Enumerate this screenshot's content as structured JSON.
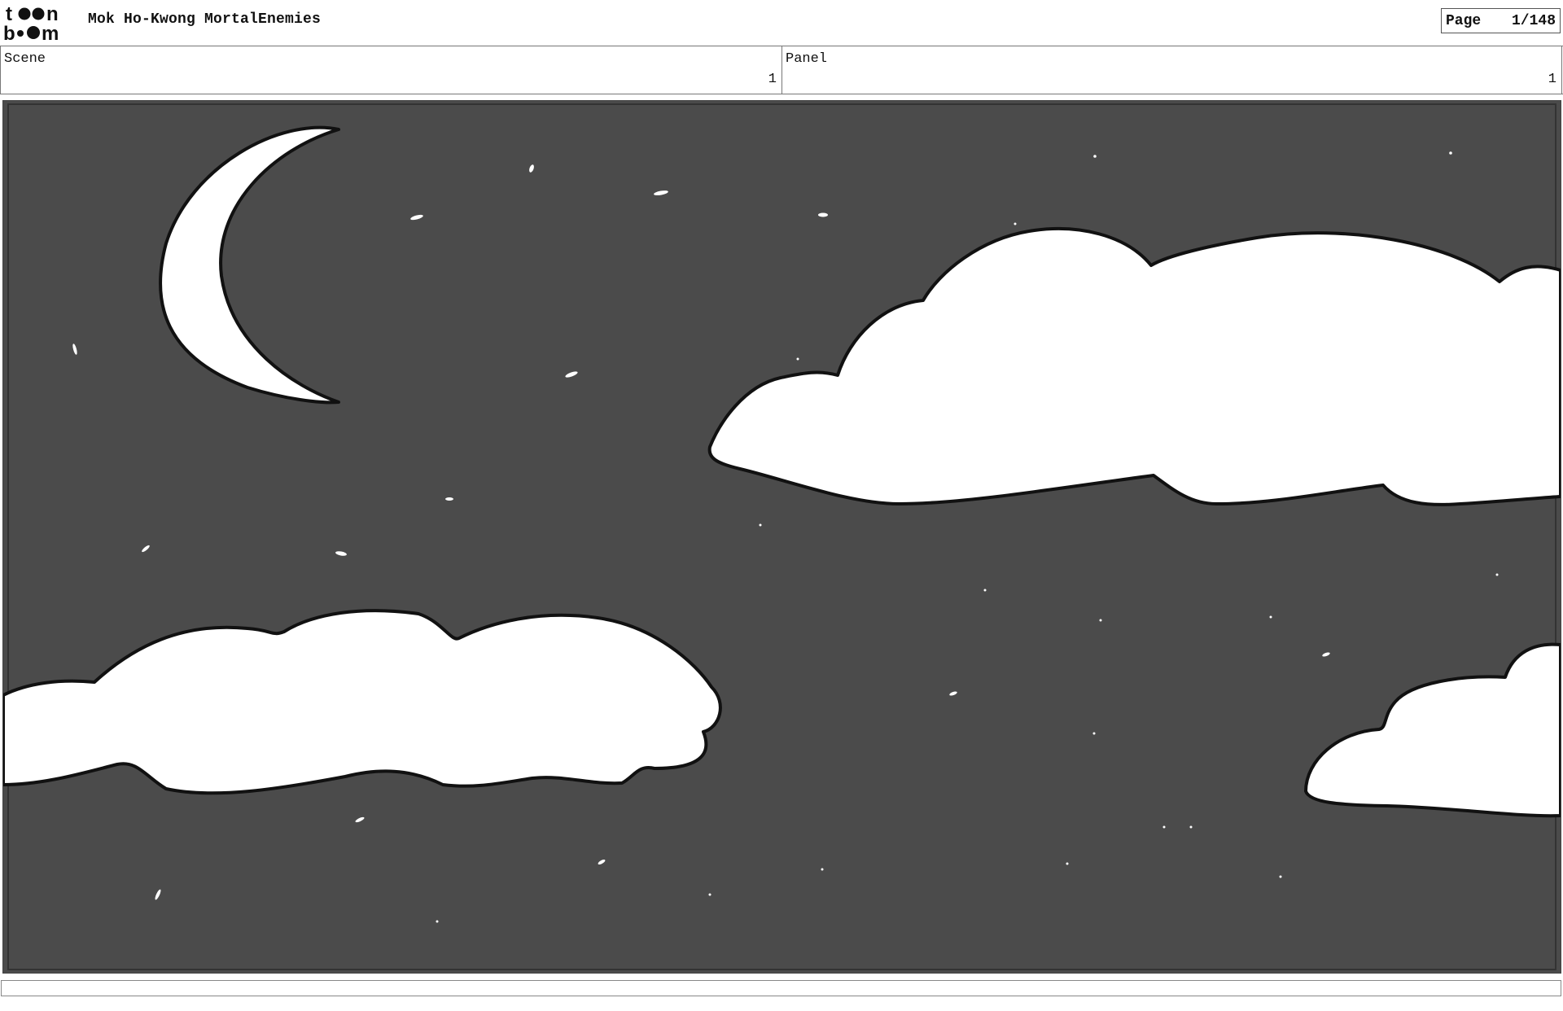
{
  "header": {
    "logo_text_top": "toon",
    "logo_text_bottom": "boom",
    "project_title": "Mok Ho-Kwong MortalEnemies",
    "page_label": "Page",
    "page_value": "1/148"
  },
  "info": {
    "scene_label": "Scene",
    "scene_value": "1",
    "panel_label": "Panel",
    "panel_value": "1"
  },
  "drawing": {
    "background_color": "#4b4b4b",
    "content": "night sky with crescent moon, three clouds and stars"
  },
  "caption": {
    "text": ""
  }
}
